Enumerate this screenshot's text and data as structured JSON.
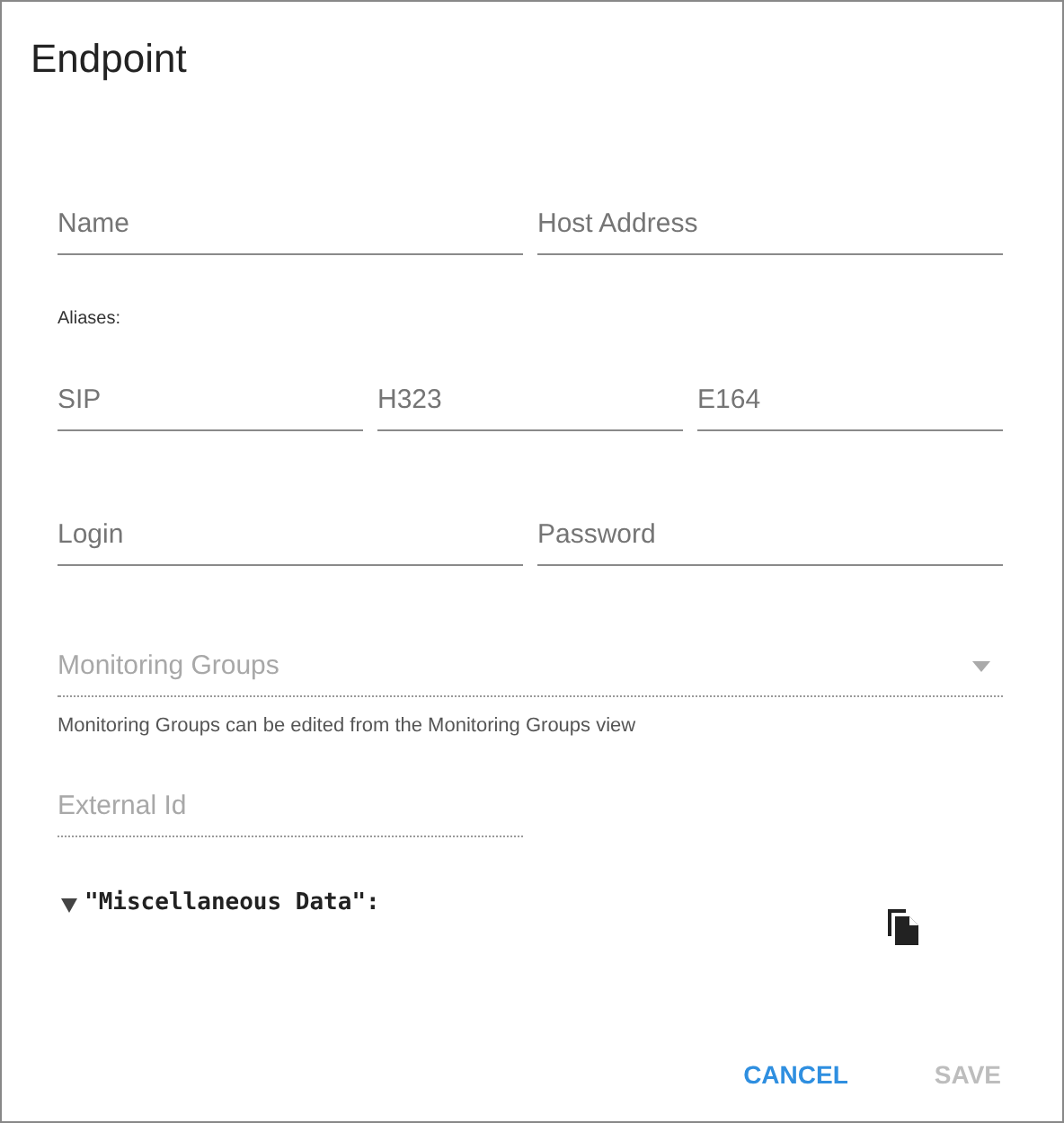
{
  "dialog": {
    "title": "Endpoint"
  },
  "rows": [
    {
      "kind": "fields",
      "fields": [
        {
          "placeholder": "Name",
          "disabled": false
        },
        {
          "placeholder": "Host Address",
          "disabled": false
        }
      ]
    },
    {
      "kind": "caption",
      "text": "Aliases:"
    },
    {
      "kind": "fields",
      "fields": [
        {
          "placeholder": "SIP",
          "disabled": false
        },
        {
          "placeholder": "H323",
          "disabled": false
        },
        {
          "placeholder": "E164",
          "disabled": false
        }
      ]
    },
    {
      "kind": "fields",
      "fields": [
        {
          "placeholder": "Login",
          "disabled": false
        },
        {
          "placeholder": "Password",
          "disabled": false
        }
      ]
    },
    {
      "kind": "select",
      "placeholder": "Monitoring Groups",
      "disabled": true,
      "helper": "Monitoring Groups can be edited from the Monitoring Groups view"
    },
    {
      "kind": "fields",
      "fields": [
        {
          "placeholder": "External Id",
          "disabled": true
        }
      ]
    },
    {
      "kind": "json",
      "key": "\"Miscellaneous Data\":",
      "expanded": true
    }
  ],
  "actions": [
    {
      "label": "CANCEL",
      "disabled": false
    },
    {
      "label": "SAVE",
      "disabled": true
    }
  ]
}
